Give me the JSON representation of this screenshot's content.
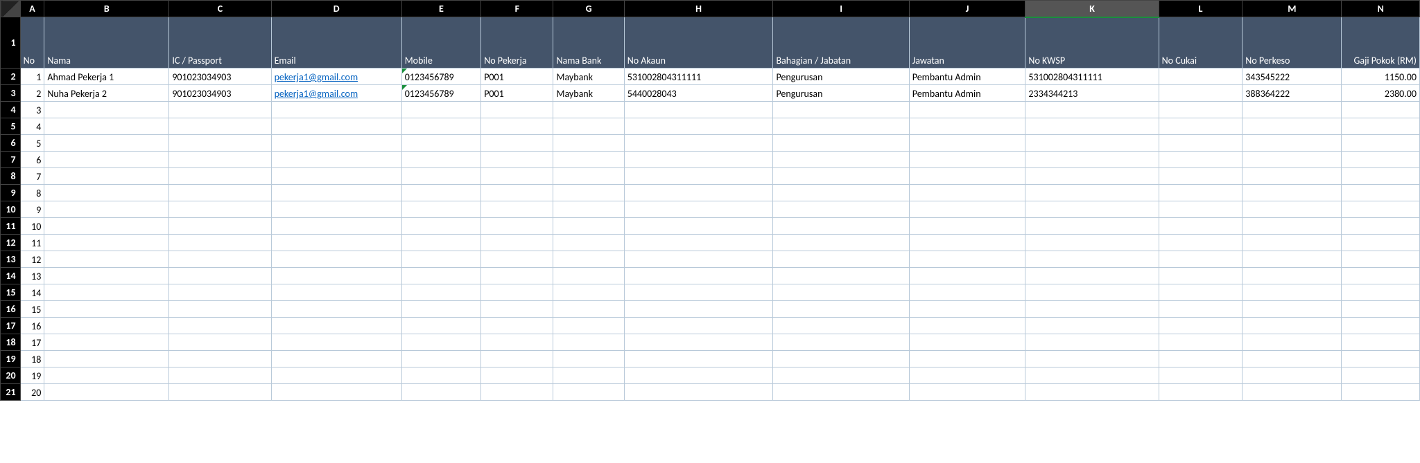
{
  "columns": [
    "A",
    "B",
    "C",
    "D",
    "E",
    "F",
    "G",
    "H",
    "I",
    "J",
    "K",
    "L",
    "M",
    "N"
  ],
  "selected_col": "K",
  "headers": {
    "A": "No",
    "B": "Nama",
    "C": "IC / Passport",
    "D": "Email",
    "E": "Mobile",
    "F": "No Pekerja",
    "G": "Nama Bank",
    "H": "No Akaun",
    "I": "Bahagian / Jabatan",
    "J": "Jawatan",
    "K": "No KWSP",
    "L": "No Cukai",
    "M": "No Perkeso",
    "N": "Gaji Pokok (RM)"
  },
  "rows": [
    {
      "no": "1",
      "nama": "Ahmad Pekerja 1",
      "ic": "901023034903",
      "email": "pekerja1@gmail.com",
      "mobile": "0123456789",
      "nopekerja": "P001",
      "bank": "Maybank",
      "akaun": "531002804311111",
      "bahagian": "Pengurusan",
      "jawatan": "Pembantu Admin",
      "kwsp": "531002804311111",
      "cukai": "",
      "perkeso": "343545222",
      "gaji": "1150.00"
    },
    {
      "no": "2",
      "nama": "Nuha Pekerja 2",
      "ic": "901023034903",
      "email": "pekerja1@gmail.com",
      "mobile": "0123456789",
      "nopekerja": "P001",
      "bank": "Maybank",
      "akaun": "5440028043",
      "bahagian": "Pengurusan",
      "jawatan": "Pembantu Admin",
      "kwsp": "2334344213",
      "cukai": "",
      "perkeso": "388364222",
      "gaji": "2380.00"
    }
  ],
  "row_numbers": [
    "1",
    "2",
    "3",
    "4",
    "5",
    "6",
    "7",
    "8",
    "9",
    "10",
    "11",
    "12",
    "13",
    "14",
    "15",
    "16",
    "17",
    "18",
    "19",
    "20",
    "21"
  ],
  "col_a_numbers": [
    "1",
    "2",
    "3",
    "4",
    "5",
    "6",
    "7",
    "8",
    "9",
    "10",
    "11",
    "12",
    "13",
    "14",
    "15",
    "16",
    "17",
    "18",
    "19",
    "20"
  ]
}
